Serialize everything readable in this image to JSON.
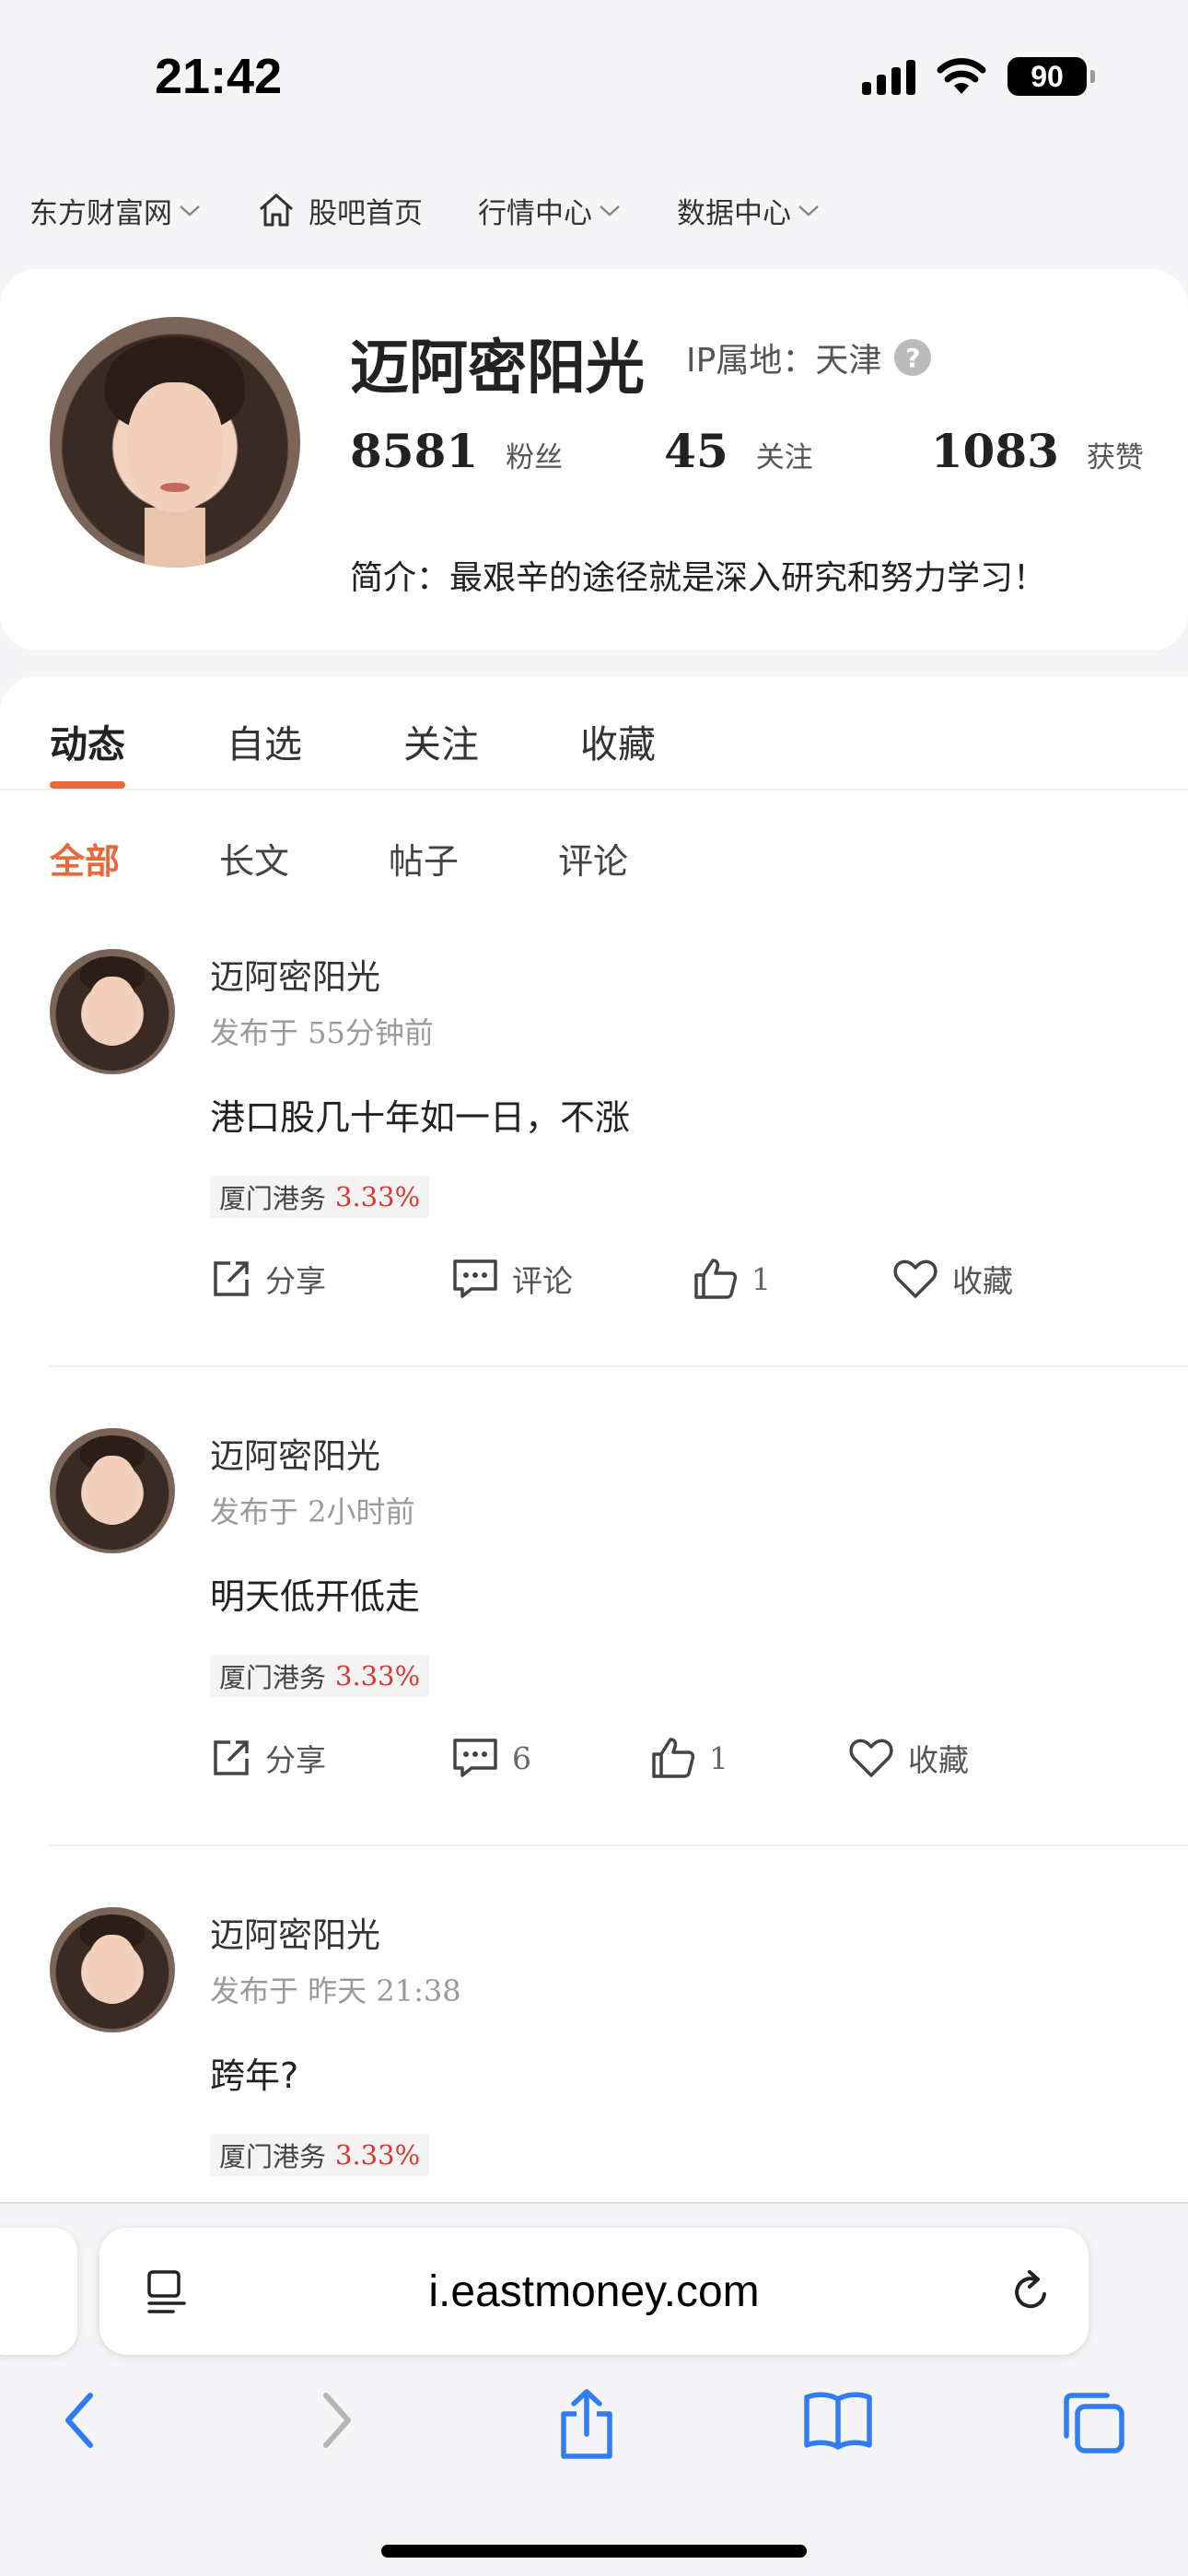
{
  "status_bar": {
    "time": "21:42",
    "battery": "90"
  },
  "top_nav": {
    "items": [
      {
        "label": "东方财富网",
        "has_chevron": true,
        "icon": null
      },
      {
        "label": "股吧首页",
        "has_chevron": false,
        "icon": "home-icon"
      },
      {
        "label": "行情中心",
        "has_chevron": true,
        "icon": null
      },
      {
        "label": "数据中心",
        "has_chevron": true,
        "icon": null
      }
    ]
  },
  "profile": {
    "name": "迈阿密阳光",
    "ip_label": "IP属地：天津",
    "stats": [
      {
        "num": "8581",
        "label": "粉丝"
      },
      {
        "num": "45",
        "label": "关注"
      },
      {
        "num": "1083",
        "label": "获赞"
      }
    ],
    "bio": "简介：最艰辛的途径就是深入研究和努力学习！"
  },
  "tabs": [
    "动态",
    "自选",
    "关注",
    "收藏"
  ],
  "active_tab": "动态",
  "subtabs": [
    "全部",
    "长文",
    "帖子",
    "评论"
  ],
  "active_subtab": "全部",
  "colors": {
    "accent": "#e8693b",
    "stock_up": "#d9382f",
    "ios_blue": "#2f7cf6"
  },
  "posts": [
    {
      "author": "迈阿密阳光",
      "time": "发布于 55分钟前",
      "text": "港口股几十年如一日，不涨",
      "stock_name": "厦门港务",
      "stock_pct": "3.33%",
      "share": "分享",
      "comment": "评论",
      "likes": "1",
      "fav": "收藏"
    },
    {
      "author": "迈阿密阳光",
      "time": "发布于 2小时前",
      "text": "明天低开低走",
      "stock_name": "厦门港务",
      "stock_pct": "3.33%",
      "share": "分享",
      "comment": "6",
      "likes": "1",
      "fav": "收藏"
    },
    {
      "author": "迈阿密阳光",
      "time": "发布于 昨天 21:38",
      "text": "跨年?",
      "stock_name": "厦门港务",
      "stock_pct": "3.33%"
    }
  ],
  "browser": {
    "url": "i.eastmoney.com"
  }
}
